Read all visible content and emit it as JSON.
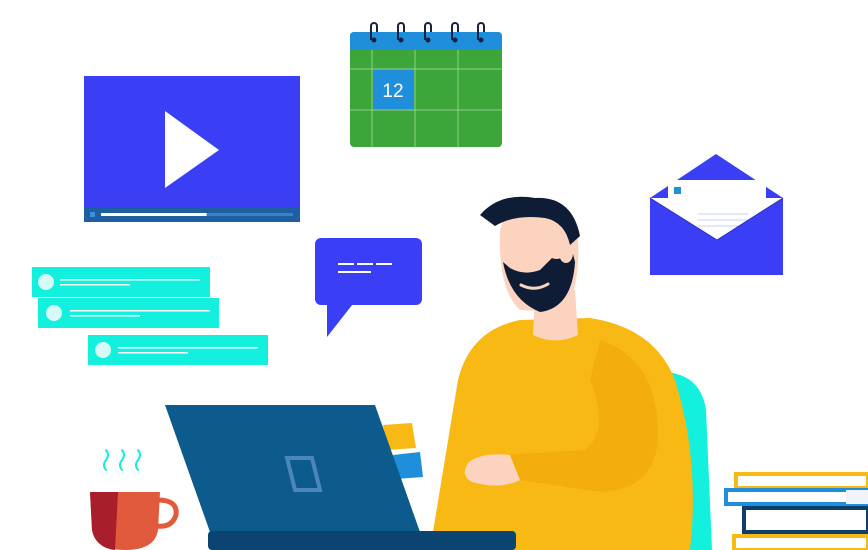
{
  "calendar": {
    "highlighted_day": "12"
  },
  "video_player": {
    "progress": 0.55
  },
  "colors": {
    "video_blue": "#3a3ff5",
    "calendar_green": "#3ca63a",
    "calendar_header": "#1f8fdc",
    "chat_teal": "#13f0de",
    "shirt_yellow": "#f8b914",
    "laptop_blue": "#0d5a8c",
    "mug_red": "#e15a3c"
  },
  "icons": [
    "calendar-icon",
    "play-icon",
    "envelope-icon",
    "chat-bubble-icon",
    "coffee-mug-icon",
    "laptop-icon",
    "books-icon"
  ]
}
